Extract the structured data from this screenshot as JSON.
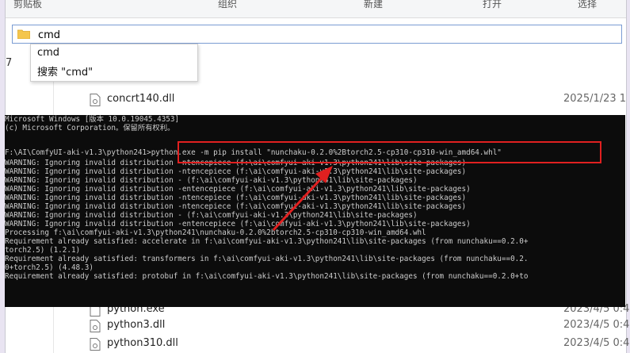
{
  "ribbon": {
    "groups": [
      "剪贴板",
      "组织",
      "新建",
      "打开",
      "选择"
    ]
  },
  "address_bar": {
    "value": "cmd"
  },
  "nav_pane": {
    "number": "7"
  },
  "autocomplete": {
    "items": [
      "cmd",
      "搜索 \"cmd\""
    ]
  },
  "files_top": [
    {
      "name": "concrt140.dll",
      "date": "2025/1/23 1",
      "icon": "file-icon"
    }
  ],
  "files_bottom": [
    {
      "name": "python.exe",
      "date": "2023/4/5 0:4",
      "icon": "file-icon"
    },
    {
      "name": "python3.dll",
      "date": "2023/4/5 0:4",
      "icon": "file-icon"
    },
    {
      "name": "python310.dll",
      "date": "2023/4/5 0:4",
      "icon": "file-icon"
    }
  ],
  "console": {
    "lines": [
      "Microsoft Windows [版本 10.0.19045.4353]",
      "(c) Microsoft Corporation。保留所有权利。",
      "",
      "F:\\AI\\ComfyUI-aki-v1.3\\python241>python.exe -m pip install \"nunchaku-0.2.0%2Btorch2.5-cp310-cp310-win_amd64.whl\"",
      "WARNING: Ignoring invalid distribution -ntencepiece (f:\\ai\\comfyui-aki-v1.3\\python241\\lib\\site-packages)",
      "WARNING: Ignoring invalid distribution -ntencepiece (f:\\ai\\comfyui-aki-v1.3\\python241\\lib\\site-packages)",
      "WARNING: Ignoring invalid distribution - (f:\\ai\\comfyui-aki-v1.3\\python241\\lib\\site-packages)",
      "WARNING: Ignoring invalid distribution -entencepiece (f:\\ai\\comfyui-aki-v1.3\\python241\\lib\\site-packages)",
      "WARNING: Ignoring invalid distribution -ntencepiece (f:\\ai\\comfyui-aki-v1.3\\python241\\lib\\site-packages)",
      "WARNING: Ignoring invalid distribution -ntencepiece (f:\\ai\\comfyui-aki-v1.3\\python241\\lib\\site-packages)",
      "WARNING: Ignoring invalid distribution - (f:\\ai\\comfyui-aki-v1.3\\python241\\lib\\site-packages)",
      "WARNING: Ignoring invalid distribution -entencepiece (f:\\ai\\comfyui-aki-v1.3\\python241\\lib\\site-packages)",
      "Processing f:\\ai\\comfyui-aki-v1.3\\python241\\nunchaku-0.2.0%2btorch2.5-cp310-cp310-win_amd64.whl",
      "Requirement already satisfied: accelerate in f:\\ai\\comfyui-aki-v1.3\\python241\\lib\\site-packages (from nunchaku==0.2.0+",
      "torch2.5) (1.2.1)",
      "Requirement already satisfied: transformers in f:\\ai\\comfyui-aki-v1.3\\python241\\lib\\site-packages (from nunchaku==0.2.",
      "0+torch2.5) (4.48.3)",
      "Requirement already satisfied: protobuf in f:\\ai\\comfyui-aki-v1.3\\python241\\lib\\site-packages (from nunchaku==0.2.0+to"
    ]
  },
  "colors": {
    "console_bg": "#0c0c0c",
    "console_fg": "#cccccc",
    "highlight": "#e02020"
  }
}
